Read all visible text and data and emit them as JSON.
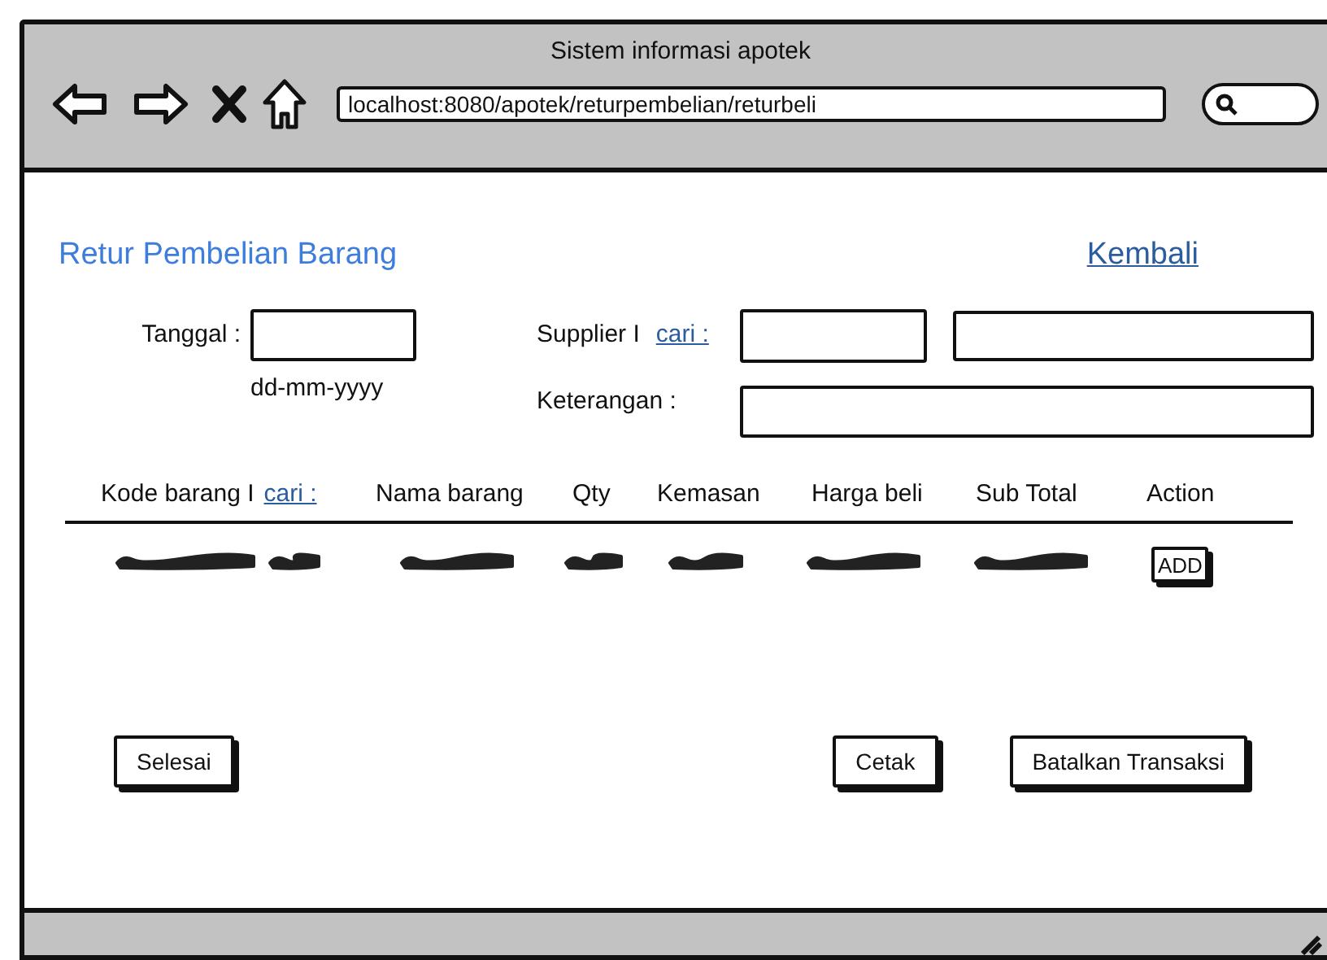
{
  "window": {
    "title": "Sistem informasi apotek",
    "url": "localhost:8080/apotek/returpembelian/returbeli"
  },
  "page": {
    "title": "Retur Pembelian Barang",
    "back_link": "Kembali"
  },
  "form": {
    "date": {
      "label": "Tanggal :",
      "hint": "dd-mm-yyyy"
    },
    "supplier": {
      "label": "Supplier I",
      "link": "cari :"
    },
    "note": {
      "label": "Keterangan :"
    }
  },
  "table": {
    "columns": [
      {
        "label": "Kode barang I",
        "link": "cari :"
      },
      {
        "label": "Nama barang"
      },
      {
        "label": "Qty"
      },
      {
        "label": "Kemasan"
      },
      {
        "label": "Harga beli"
      },
      {
        "label": "Sub Total"
      },
      {
        "label": "Action"
      }
    ],
    "rows": [
      {
        "action": "ADD"
      }
    ]
  },
  "buttons_left": [
    {
      "label": "Selesai"
    }
  ],
  "buttons_right": [
    {
      "label": "Cetak"
    },
    {
      "label": "Batalkan Transaksi"
    }
  ]
}
